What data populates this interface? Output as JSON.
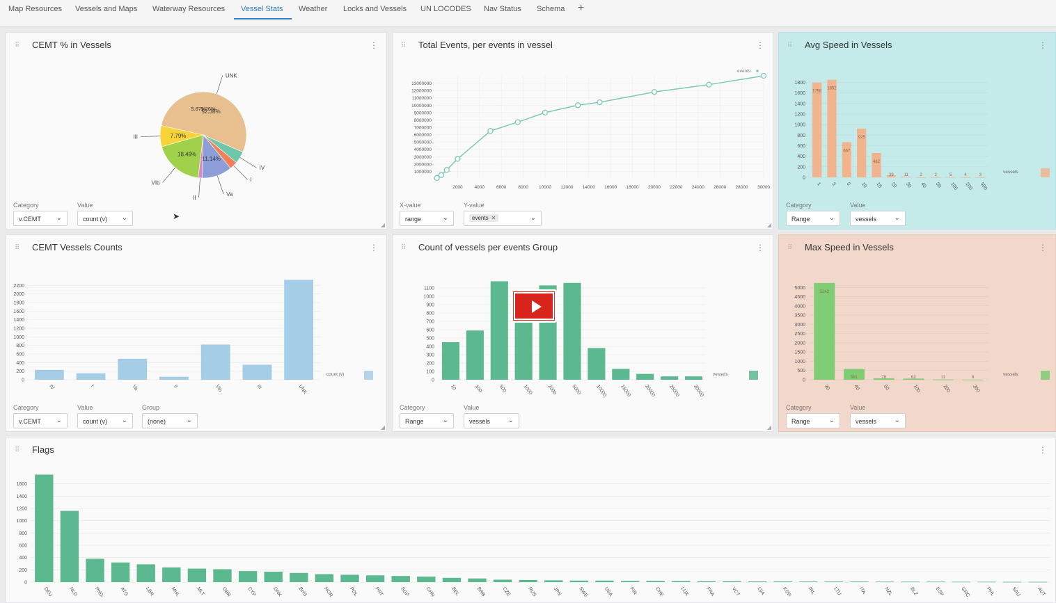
{
  "tabs": [
    {
      "label": "Map Resources",
      "left": 12
    },
    {
      "label": "Vessels and Maps",
      "left": 108
    },
    {
      "label": "Waterway Resources",
      "left": 219
    },
    {
      "label": "Vessel Stats",
      "left": 346,
      "active": true
    },
    {
      "label": "Weather",
      "left": 429
    },
    {
      "label": "Locks and Vessels",
      "left": 493
    },
    {
      "label": "UN LOCODES",
      "left": 604
    },
    {
      "label": "Nav Status",
      "left": 695
    },
    {
      "label": "Schema",
      "left": 771
    }
  ],
  "add_tab_label": "+",
  "panels": {
    "cemt_pct": {
      "title": "CEMT % in Vessels",
      "category_label": "Category",
      "category_value": "v.CEMT",
      "value_label": "Value",
      "value_value": "count (v)"
    },
    "total_events": {
      "title": "Total Events, per events in vessel",
      "x_label": "X-value",
      "x_value": "range",
      "y_label": "Y-value",
      "y_chip": "events"
    },
    "avg_speed": {
      "title": "Avg Speed in Vessels",
      "category_label": "Category",
      "category_value": "Range",
      "value_label": "Value",
      "value_value": "vessels"
    },
    "cemt_counts": {
      "title": "CEMT Vessels Counts",
      "category_label": "Category",
      "category_value": "v.CEMT",
      "value_label": "Value",
      "value_value": "count (v)",
      "group_label": "Group",
      "group_value": "(none)"
    },
    "events_group": {
      "title": "Count of vessels per events Group",
      "category_label": "Category",
      "category_value": "Range",
      "value_label": "Value",
      "value_value": "vessels"
    },
    "max_speed": {
      "title": "Max Speed in Vessels",
      "category_label": "Category",
      "category_value": "Range",
      "value_label": "Value",
      "value_value": "vessels"
    },
    "flags": {
      "title": "Flags"
    }
  },
  "colors": {
    "blue": "#a6cde6",
    "green": "#5cb88f",
    "peach": "#f2b48f",
    "lightgreen": "#7fcc72",
    "teal": "#7cc9b4"
  },
  "chart_data": [
    {
      "id": "cemt_pie",
      "type": "pie",
      "slices": [
        {
          "label": "UNK",
          "value": 52.38,
          "pct_label": "52.38%",
          "color": "#e8c08f"
        },
        {
          "label": "IV",
          "value": 4.5,
          "color": "#6ec7a8"
        },
        {
          "label": "I",
          "value": 3.0,
          "color": "#f07f5a"
        },
        {
          "label": "Va",
          "value": 11.14,
          "pct_label": "11.14%",
          "color": "#8c9ed6"
        },
        {
          "label": "II",
          "value": 1.5,
          "color": "#d98ac4"
        },
        {
          "label": "VIb",
          "value": 18.49,
          "pct_label": "18.49%",
          "color": "#9fd24a"
        },
        {
          "label": "III",
          "value": 7.79,
          "pct_label": "7.79%",
          "color": "#f6d43a"
        }
      ],
      "extra_labels": [
        "5.87%",
        "3.26%"
      ]
    },
    {
      "id": "events_line",
      "type": "line",
      "legend": "events",
      "x": [
        100,
        500,
        1000,
        2000,
        5000,
        7500,
        10000,
        13000,
        15000,
        20000,
        25000,
        30000
      ],
      "y": [
        100000,
        500000,
        1200000,
        2700000,
        6500000,
        7700000,
        9000000,
        10000000,
        10400000,
        11800000,
        12800000,
        14000000
      ],
      "xlim": [
        0,
        30000
      ],
      "ylim": [
        0,
        14000000
      ],
      "xticks": [
        "2000",
        "4000",
        "6000",
        "8000",
        "10000",
        "12000",
        "14000",
        "16000",
        "18000",
        "20000",
        "22000",
        "24000",
        "26000",
        "28000",
        "30000"
      ],
      "yticks": [
        "1000000",
        "2000000",
        "3000000",
        "4000000",
        "5000000",
        "6000000",
        "7000000",
        "8000000",
        "9000000",
        "10000000",
        "11000000",
        "12000000",
        "13000000"
      ]
    },
    {
      "id": "avg_speed_bar",
      "type": "bar",
      "legend": "vessels",
      "categories": [
        "1",
        "3",
        "5",
        "10",
        "15",
        "20",
        "30",
        "40",
        "50",
        "100",
        "200",
        "300"
      ],
      "values": [
        1798,
        1852,
        667,
        925,
        462,
        39,
        11,
        2,
        2,
        5,
        4,
        3
      ],
      "labels": [
        "1798",
        "1852",
        "667",
        "925",
        "462",
        "39",
        "11",
        "2",
        "2",
        "5",
        "4",
        "3"
      ],
      "ylim": [
        0,
        1900
      ],
      "yticks": [
        "0",
        "200",
        "400",
        "600",
        "800",
        "1000",
        "1200",
        "1400",
        "1600",
        "1800"
      ]
    },
    {
      "id": "cemt_counts_bar",
      "type": "bar",
      "legend": "count (v)",
      "categories": [
        "IV",
        "I",
        "Va",
        "II",
        "VIb",
        "III",
        "UNK"
      ],
      "values": [
        230,
        150,
        490,
        70,
        820,
        350,
        2330
      ],
      "ylim": [
        0,
        2400
      ],
      "yticks": [
        "0",
        "200",
        "400",
        "600",
        "800",
        "1000",
        "1200",
        "1400",
        "1600",
        "1800",
        "2000",
        "2200"
      ]
    },
    {
      "id": "events_group_bar",
      "type": "bar",
      "legend": "vessels",
      "categories": [
        "10",
        "100",
        "500",
        "1000",
        "2000",
        "5000",
        "10000",
        "15000",
        "20000",
        "25000",
        "30000"
      ],
      "values": [
        450,
        590,
        1180,
        1020,
        1130,
        1160,
        380,
        130,
        70,
        40,
        40
      ],
      "ylim": [
        0,
        1200
      ],
      "yticks": [
        "0",
        "100",
        "200",
        "300",
        "400",
        "500",
        "600",
        "700",
        "800",
        "900",
        "1000",
        "1100"
      ]
    },
    {
      "id": "max_speed_bar",
      "type": "bar",
      "legend": "vessels",
      "categories": [
        "30",
        "40",
        "50",
        "100",
        "200",
        "300"
      ],
      "values": [
        5242,
        581,
        78,
        62,
        11,
        6
      ],
      "labels": [
        "5242",
        "581",
        "78",
        "62",
        "11",
        "6"
      ],
      "ylim": [
        0,
        5500
      ],
      "yticks": [
        "0",
        "500",
        "1000",
        "1500",
        "2000",
        "2500",
        "3000",
        "3500",
        "4000",
        "4500",
        "5000"
      ]
    },
    {
      "id": "flags_bar",
      "type": "bar",
      "categories": [
        "DEU",
        "NLD",
        "PNG",
        "ATG",
        "LBR",
        "MHL",
        "MLT",
        "GBR",
        "CYP",
        "DNK",
        "BHS",
        "NOR",
        "POL",
        "PRT",
        "SGP",
        "CHN",
        "BEL",
        "BRB",
        "CZE",
        "RUS",
        "JPN",
        "SWE",
        "USA",
        "FIN",
        "CHE",
        "LUX",
        "FRA",
        "VCT",
        "LVA",
        "KOR",
        "IRL",
        "LTU",
        "ITA",
        "NZL",
        "BLZ",
        "ESP",
        "GRC",
        "PHL",
        "SAU",
        "AUT"
      ],
      "values": [
        1750,
        1160,
        380,
        320,
        290,
        240,
        220,
        210,
        180,
        170,
        150,
        130,
        120,
        110,
        100,
        90,
        70,
        60,
        40,
        35,
        30,
        25,
        25,
        20,
        20,
        18,
        15,
        15,
        12,
        12,
        10,
        10,
        10,
        8,
        8,
        8,
        6,
        6,
        5,
        5
      ],
      "ylim": [
        0,
        1800
      ],
      "yticks": [
        "0",
        "200",
        "400",
        "600",
        "800",
        "1000",
        "1200",
        "1400",
        "1600"
      ]
    }
  ]
}
